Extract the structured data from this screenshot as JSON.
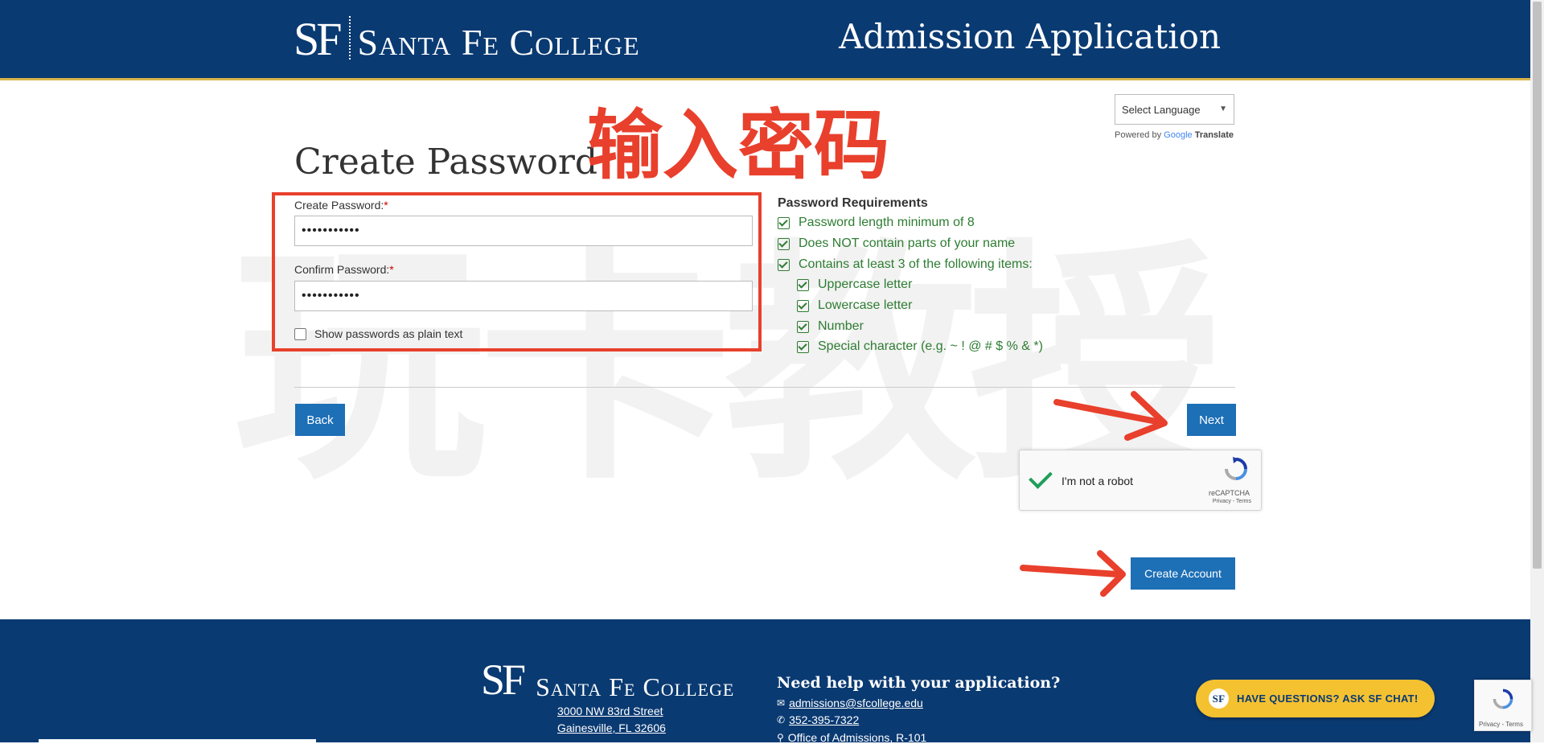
{
  "header": {
    "logo_mark": "SF",
    "logo_name": "Santa Fe College",
    "title": "Admission Application"
  },
  "translate": {
    "select_label": "Select Language",
    "powered_by": "Powered by",
    "google": "Google",
    "translate": "Translate"
  },
  "page": {
    "title": "Create Password",
    "annotation": "输入密码",
    "watermark": "玩卡教授"
  },
  "form": {
    "create_label": "Create Password:",
    "confirm_label": "Confirm Password:",
    "required_mark": "*",
    "create_value": "•••••••••••",
    "confirm_value": "•••••••••••",
    "show_plain_label": "Show passwords as plain text"
  },
  "requirements": {
    "title": "Password Requirements",
    "items": [
      "Password length minimum of 8",
      "Does NOT contain parts of your name",
      "Contains at least 3 of the following items:",
      "Uppercase letter",
      "Lowercase letter",
      "Number",
      "Special character (e.g. ~ ! @ # $ % & *)"
    ]
  },
  "buttons": {
    "back": "Back",
    "next": "Next",
    "create_account": "Create Account"
  },
  "captcha": {
    "label": "I'm not a robot",
    "brand": "reCAPTCHA",
    "links": "Privacy - Terms"
  },
  "footer": {
    "logo_mark": "SF",
    "logo_name": "Santa Fe College",
    "address1": "3000 NW 83rd Street",
    "address2": "Gainesville, FL 32606",
    "help_title": "Need help with your application?",
    "email": "admissions@sfcollege.edu",
    "phone": "352-395-7322",
    "office": "Office of Admissions, R-101"
  },
  "chat": {
    "avatar": "SF",
    "label": "HAVE QUESTIONS? ASK SF CHAT!"
  },
  "recaptcha_badge": {
    "links": "Privacy - Terms"
  },
  "colors": {
    "brand_navy": "#0a3a72",
    "gold": "#d8b44a",
    "button_blue": "#1d6fb6",
    "annotation_red": "#e8402c",
    "requirement_green": "#2e7d32",
    "chat_yellow": "#f4c131"
  },
  "icons": {
    "checkbox": "check-square-icon",
    "email": "envelope-icon",
    "phone": "phone-icon",
    "location": "map-marker-icon",
    "recaptcha": "recaptcha-icon",
    "arrow": "red-arrow-icon"
  }
}
